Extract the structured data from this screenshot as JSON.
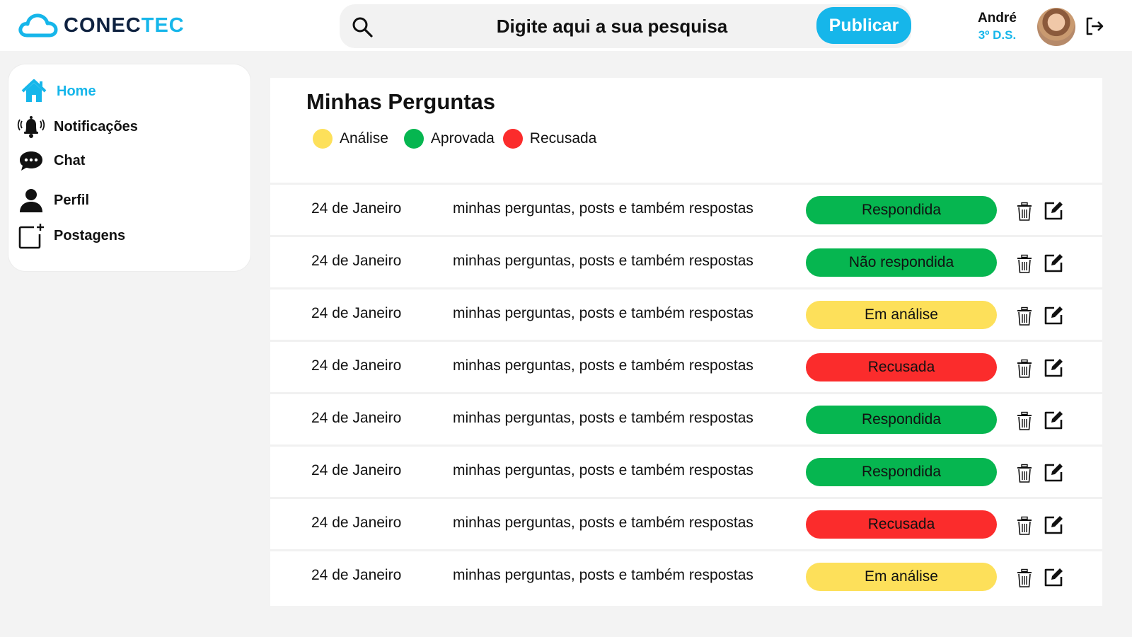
{
  "header": {
    "logo_part1": "CONEC",
    "logo_part2": "TEC",
    "search_placeholder": "Digite aqui a sua pesquisa",
    "publish_label": "Publicar",
    "user_name": "André",
    "user_class": "3º D.S."
  },
  "sidebar": {
    "items": [
      {
        "label": "Home",
        "icon": "home-icon",
        "active": true
      },
      {
        "label": "Notificações",
        "icon": "bell-icon"
      },
      {
        "label": "Chat",
        "icon": "chat-icon"
      },
      {
        "label": "Perfil",
        "icon": "user-icon"
      },
      {
        "label": "Postagens",
        "icon": "add-post-icon"
      }
    ]
  },
  "main": {
    "title": "Minhas Perguntas",
    "legend": [
      {
        "label": "Análise",
        "color": "#fde05a"
      },
      {
        "label": "Aprovada",
        "color": "#06b650"
      },
      {
        "label": "Recusada",
        "color": "#fb2c2c"
      }
    ],
    "rows": [
      {
        "date": "24 de Janeiro",
        "text": "minhas perguntas, posts e também respostas",
        "status": "Respondida",
        "status_color": "#06b650"
      },
      {
        "date": "24 de Janeiro",
        "text": "minhas perguntas, posts e também respostas",
        "status": "Não respondida",
        "status_color": "#06b650"
      },
      {
        "date": "24 de Janeiro",
        "text": "minhas perguntas, posts e também respostas",
        "status": "Em análise",
        "status_color": "#fde05a"
      },
      {
        "date": "24 de Janeiro",
        "text": "minhas perguntas, posts e também respostas",
        "status": "Recusada",
        "status_color": "#fb2c2c"
      },
      {
        "date": "24 de Janeiro",
        "text": "minhas perguntas, posts e também respostas",
        "status": "Respondida",
        "status_color": "#06b650"
      },
      {
        "date": "24 de Janeiro",
        "text": "minhas perguntas, posts e também respostas",
        "status": "Respondida",
        "status_color": "#06b650"
      },
      {
        "date": "24 de Janeiro",
        "text": "minhas perguntas, posts e também respostas",
        "status": "Recusada",
        "status_color": "#fb2c2c"
      },
      {
        "date": "24 de Janeiro",
        "text": "minhas perguntas, posts e também respostas",
        "status": "Em análise",
        "status_color": "#fde05a"
      }
    ]
  },
  "colors": {
    "accent": "#16b6ea",
    "logo_dark": "#0f2240"
  }
}
